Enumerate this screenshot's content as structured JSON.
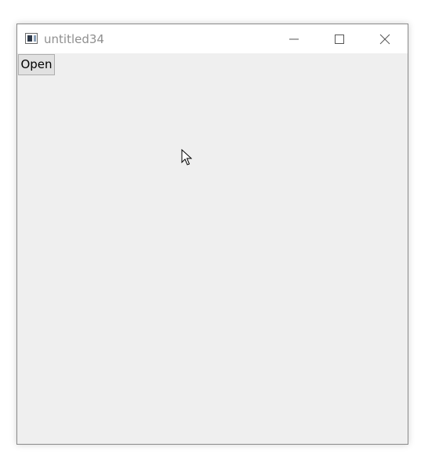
{
  "window": {
    "title": "untitled34",
    "controls": {
      "minimize": "minimize-icon",
      "maximize": "maximize-icon",
      "close": "close-icon"
    }
  },
  "content": {
    "open_button_label": "Open"
  },
  "colors": {
    "titlebar_bg": "#ffffff",
    "title_text": "#8f8f8f",
    "content_bg": "#efefef",
    "button_bg": "#e1e1e1",
    "button_border": "#adadad"
  }
}
